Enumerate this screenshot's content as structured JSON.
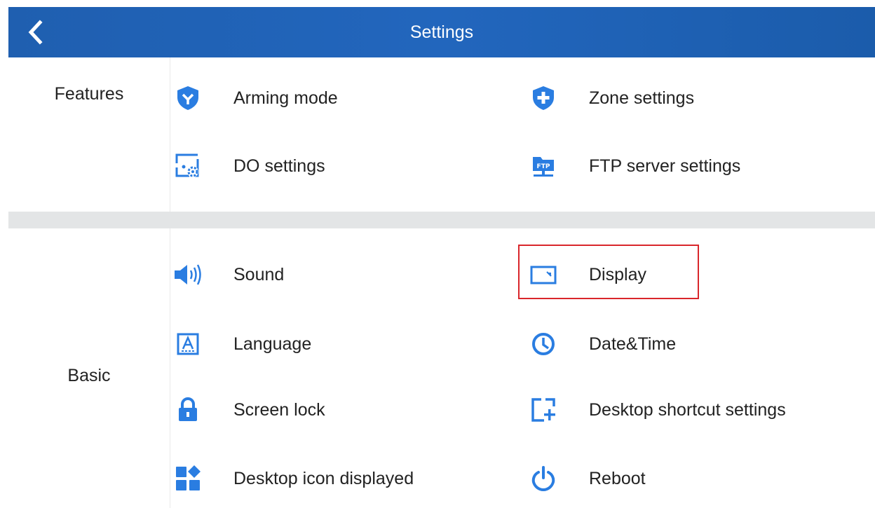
{
  "header": {
    "title": "Settings",
    "back_icon": "chevron-left-icon"
  },
  "colors": {
    "header_blue": "#1f5fb0",
    "icon_blue": "#2a7de1",
    "highlight_red": "#d9262b",
    "section_gap": "#e3e5e6"
  },
  "features": {
    "label": "Features",
    "items": [
      {
        "label": "Arming mode",
        "icon": "shield-check-icon"
      },
      {
        "label": "Zone settings",
        "icon": "shield-plus-icon"
      },
      {
        "label": "DO settings",
        "icon": "do-settings-icon"
      },
      {
        "label": "FTP server settings",
        "icon": "ftp-server-icon"
      }
    ]
  },
  "basic": {
    "label": "Basic",
    "items": [
      {
        "label": "Sound",
        "icon": "speaker-icon"
      },
      {
        "label": "Display",
        "icon": "display-icon",
        "highlighted": true
      },
      {
        "label": "Language",
        "icon": "language-icon"
      },
      {
        "label": "Date&Time",
        "icon": "clock-icon"
      },
      {
        "label": "Screen lock",
        "icon": "lock-icon"
      },
      {
        "label": "Desktop shortcut settings",
        "icon": "desktop-shortcut-icon"
      },
      {
        "label": "Desktop icon displayed",
        "icon": "app-grid-icon"
      },
      {
        "label": "Reboot",
        "icon": "power-icon"
      }
    ]
  }
}
